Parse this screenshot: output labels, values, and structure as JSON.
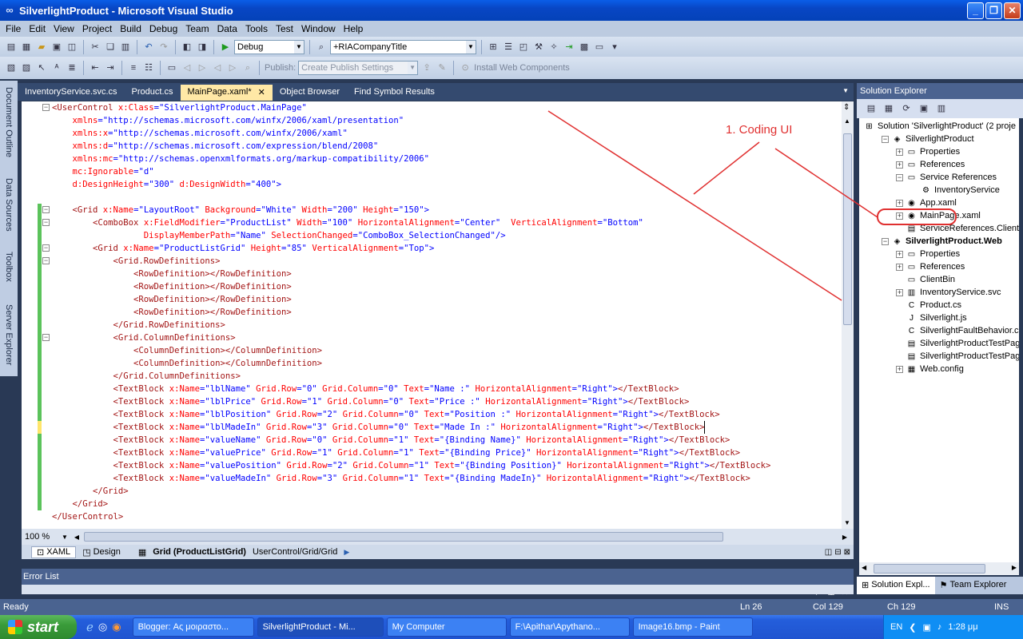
{
  "window": {
    "title": "SilverlightProduct - Microsoft Visual Studio"
  },
  "menu": [
    "File",
    "Edit",
    "View",
    "Project",
    "Build",
    "Debug",
    "Team",
    "Data",
    "Tools",
    "Test",
    "Window",
    "Help"
  ],
  "toolbar": {
    "config": "Debug",
    "startup": "+RIACompanyTitle",
    "publish_label": "Publish:",
    "publish_value": "Create Publish Settings",
    "install": "Install Web Components"
  },
  "left_rail": [
    "Document Outline",
    "Data Sources",
    "Toolbox",
    "Server Explorer"
  ],
  "tabs": [
    {
      "label": "InventoryService.svc.cs"
    },
    {
      "label": "Product.cs"
    },
    {
      "label": "MainPage.xaml*"
    },
    {
      "label": "Object Browser"
    },
    {
      "label": "Find Symbol Results"
    }
  ],
  "code": [
    [
      [
        "t",
        "<UserControl "
      ],
      [
        "a",
        "x:Class"
      ],
      [
        "b",
        "=\"SilverlightProduct.MainPage\""
      ]
    ],
    [
      [
        "a",
        "    xmlns"
      ],
      [
        "b",
        "=\"http://schemas.microsoft.com/winfx/2006/xaml/presentation\""
      ]
    ],
    [
      [
        "a",
        "    xmlns:x"
      ],
      [
        "b",
        "=\"http://schemas.microsoft.com/winfx/2006/xaml\""
      ]
    ],
    [
      [
        "a",
        "    xmlns:d"
      ],
      [
        "b",
        "=\"http://schemas.microsoft.com/expression/blend/2008\""
      ]
    ],
    [
      [
        "a",
        "    xmlns:mc"
      ],
      [
        "b",
        "=\"http://schemas.openxmlformats.org/markup-compatibility/2006\""
      ]
    ],
    [
      [
        "a",
        "    mc:Ignorable"
      ],
      [
        "b",
        "=\"d\""
      ]
    ],
    [
      [
        "a",
        "    d:DesignHeight"
      ],
      [
        "b",
        "=\"300\" "
      ],
      [
        "a",
        "d:DesignWidth"
      ],
      [
        "b",
        "=\"400\">"
      ]
    ],
    [],
    [
      [
        "t",
        "    <Grid "
      ],
      [
        "a",
        "x:Name"
      ],
      [
        "b",
        "=\"LayoutRoot\" "
      ],
      [
        "a",
        "Background"
      ],
      [
        "b",
        "=\"White\" "
      ],
      [
        "a",
        "Width"
      ],
      [
        "b",
        "=\"200\" "
      ],
      [
        "a",
        "Height"
      ],
      [
        "b",
        "=\"150\">"
      ]
    ],
    [
      [
        "t",
        "        <ComboBox "
      ],
      [
        "a",
        "x:FieldModifier"
      ],
      [
        "b",
        "=\"ProductList\" "
      ],
      [
        "a",
        "Width"
      ],
      [
        "b",
        "=\"100\" "
      ],
      [
        "a",
        "HorizontalAlignment"
      ],
      [
        "b",
        "=\"Center\"  "
      ],
      [
        "a",
        "VerticalAlignment"
      ],
      [
        "b",
        "=\"Bottom\""
      ]
    ],
    [
      [
        "a",
        "                  DisplayMemberPath"
      ],
      [
        "b",
        "=\"Name\" "
      ],
      [
        "a",
        "SelectionChanged"
      ],
      [
        "b",
        "=\"ComboBox_SelectionChanged\"/>"
      ]
    ],
    [
      [
        "t",
        "        <Grid "
      ],
      [
        "a",
        "x:Name"
      ],
      [
        "b",
        "=\"ProductListGrid\" "
      ],
      [
        "a",
        "Height"
      ],
      [
        "b",
        "=\"85\" "
      ],
      [
        "a",
        "VerticalAlignment"
      ],
      [
        "b",
        "=\"Top\">"
      ]
    ],
    [
      [
        "t",
        "            <Grid.RowDefinitions>"
      ]
    ],
    [
      [
        "t",
        "                <RowDefinition></RowDefinition>"
      ]
    ],
    [
      [
        "t",
        "                <RowDefinition></RowDefinition>"
      ]
    ],
    [
      [
        "t",
        "                <RowDefinition></RowDefinition>"
      ]
    ],
    [
      [
        "t",
        "                <RowDefinition></RowDefinition>"
      ]
    ],
    [
      [
        "t",
        "            </Grid.RowDefinitions>"
      ]
    ],
    [
      [
        "t",
        "            <Grid.ColumnDefinitions>"
      ]
    ],
    [
      [
        "t",
        "                <ColumnDefinition></ColumnDefinition>"
      ]
    ],
    [
      [
        "t",
        "                <ColumnDefinition></ColumnDefinition>"
      ]
    ],
    [
      [
        "t",
        "            </Grid.ColumnDefinitions>"
      ]
    ],
    [
      [
        "t",
        "            <TextBlock "
      ],
      [
        "a",
        "x:Name"
      ],
      [
        "b",
        "=\"lblName\" "
      ],
      [
        "a",
        "Grid.Row"
      ],
      [
        "b",
        "=\"0\" "
      ],
      [
        "a",
        "Grid.Column"
      ],
      [
        "b",
        "=\"0\" "
      ],
      [
        "a",
        "Text"
      ],
      [
        "b",
        "=\"Name :\" "
      ],
      [
        "a",
        "HorizontalAlignment"
      ],
      [
        "b",
        "=\"Right\">"
      ],
      [
        "t",
        "</TextBlock>"
      ]
    ],
    [
      [
        "t",
        "            <TextBlock "
      ],
      [
        "a",
        "x:Name"
      ],
      [
        "b",
        "=\"lblPrice\" "
      ],
      [
        "a",
        "Grid.Row"
      ],
      [
        "b",
        "=\"1\" "
      ],
      [
        "a",
        "Grid.Column"
      ],
      [
        "b",
        "=\"0\" "
      ],
      [
        "a",
        "Text"
      ],
      [
        "b",
        "=\"Price :\" "
      ],
      [
        "a",
        "HorizontalAlignment"
      ],
      [
        "b",
        "=\"Right\">"
      ],
      [
        "t",
        "</TextBlock>"
      ]
    ],
    [
      [
        "t",
        "            <TextBlock "
      ],
      [
        "a",
        "x:Name"
      ],
      [
        "b",
        "=\"lblPosition\" "
      ],
      [
        "a",
        "Grid.Row"
      ],
      [
        "b",
        "=\"2\" "
      ],
      [
        "a",
        "Grid.Column"
      ],
      [
        "b",
        "=\"0\" "
      ],
      [
        "a",
        "Text"
      ],
      [
        "b",
        "=\"Position :\" "
      ],
      [
        "a",
        "HorizontalAlignment"
      ],
      [
        "b",
        "=\"Right\">"
      ],
      [
        "t",
        "</TextBlock>"
      ]
    ],
    [
      [
        "t",
        "            <TextBlock "
      ],
      [
        "a",
        "x:Name"
      ],
      [
        "b",
        "=\"lblMadeIn\" "
      ],
      [
        "a",
        "Grid.Row"
      ],
      [
        "b",
        "=\"3\" "
      ],
      [
        "a",
        "Grid.Column"
      ],
      [
        "b",
        "=\"0\" "
      ],
      [
        "a",
        "Text"
      ],
      [
        "b",
        "=\"Made In :\" "
      ],
      [
        "a",
        "HorizontalAlignment"
      ],
      [
        "b",
        "=\"Right\">"
      ],
      [
        "t",
        "</TextBlock>"
      ]
    ],
    [
      [
        "t",
        "            <TextBlock "
      ],
      [
        "a",
        "x:Name"
      ],
      [
        "b",
        "=\"valueName\" "
      ],
      [
        "a",
        "Grid.Row"
      ],
      [
        "b",
        "=\"0\" "
      ],
      [
        "a",
        "Grid.Column"
      ],
      [
        "b",
        "=\"1\" "
      ],
      [
        "a",
        "Text"
      ],
      [
        "b",
        "=\"{Binding Name}\" "
      ],
      [
        "a",
        "HorizontalAlignment"
      ],
      [
        "b",
        "=\"Right\">"
      ],
      [
        "t",
        "</TextBlock>"
      ]
    ],
    [
      [
        "t",
        "            <TextBlock "
      ],
      [
        "a",
        "x:Name"
      ],
      [
        "b",
        "=\"valuePrice\" "
      ],
      [
        "a",
        "Grid.Row"
      ],
      [
        "b",
        "=\"1\" "
      ],
      [
        "a",
        "Grid.Column"
      ],
      [
        "b",
        "=\"1\" "
      ],
      [
        "a",
        "Text"
      ],
      [
        "b",
        "=\"{Binding Price}\" "
      ],
      [
        "a",
        "HorizontalAlignment"
      ],
      [
        "b",
        "=\"Right\">"
      ],
      [
        "t",
        "</TextBlock>"
      ]
    ],
    [
      [
        "t",
        "            <TextBlock "
      ],
      [
        "a",
        "x:Name"
      ],
      [
        "b",
        "=\"valuePosition\" "
      ],
      [
        "a",
        "Grid.Row"
      ],
      [
        "b",
        "=\"2\" "
      ],
      [
        "a",
        "Grid.Column"
      ],
      [
        "b",
        "=\"1\" "
      ],
      [
        "a",
        "Text"
      ],
      [
        "b",
        "=\"{Binding Position}\" "
      ],
      [
        "a",
        "HorizontalAlignment"
      ],
      [
        "b",
        "=\"Right\">"
      ],
      [
        "t",
        "</TextBlock>"
      ]
    ],
    [
      [
        "t",
        "            <TextBlock "
      ],
      [
        "a",
        "x:Name"
      ],
      [
        "b",
        "=\"valueMadeIn\" "
      ],
      [
        "a",
        "Grid.Row"
      ],
      [
        "b",
        "=\"3\" "
      ],
      [
        "a",
        "Grid.Column"
      ],
      [
        "b",
        "=\"1\" "
      ],
      [
        "a",
        "Text"
      ],
      [
        "b",
        "=\"{Binding MadeIn}\" "
      ],
      [
        "a",
        "HorizontalAlignment"
      ],
      [
        "b",
        "=\"Right\">"
      ],
      [
        "t",
        "</TextBlock>"
      ]
    ],
    [
      [
        "t",
        "        </Grid>"
      ]
    ],
    [
      [
        "t",
        "    </Grid>"
      ]
    ],
    [
      [
        "t",
        "</UserControl>"
      ]
    ]
  ],
  "editor": {
    "zoom": "100 %",
    "view_xaml": "XAML",
    "view_design": "Design",
    "breadcrumb_bold": "Grid (ProductListGrid)",
    "breadcrumb_path": "UserControl/Grid/Grid"
  },
  "error_list": {
    "title": "Error List"
  },
  "solution_explorer": {
    "title": "Solution Explorer",
    "items": [
      {
        "label": "Solution 'SilverlightProduct' (2 proje",
        "icon": "solution-icon",
        "bold": false
      },
      {
        "label": "SilverlightProduct",
        "icon": "project-icon",
        "bold": false
      },
      {
        "label": "Properties",
        "icon": "folder-icon",
        "bold": false
      },
      {
        "label": "References",
        "icon": "folder-icon",
        "bold": false
      },
      {
        "label": "Service References",
        "icon": "folder-icon",
        "bold": false
      },
      {
        "label": "InventoryService",
        "icon": "service-icon",
        "bold": false
      },
      {
        "label": "App.xaml",
        "icon": "xaml-icon",
        "bold": false
      },
      {
        "label": "MainPage.xaml",
        "icon": "xaml-icon",
        "bold": false
      },
      {
        "label": "ServiceReferences.ClientCo",
        "icon": "file-icon",
        "bold": false
      },
      {
        "label": "SilverlightProduct.Web",
        "icon": "web-project-icon",
        "bold": true
      },
      {
        "label": "Properties",
        "icon": "folder-icon",
        "bold": false
      },
      {
        "label": "References",
        "icon": "folder-icon",
        "bold": false
      },
      {
        "label": "ClientBin",
        "icon": "folder-icon",
        "bold": false
      },
      {
        "label": "InventoryService.svc",
        "icon": "svc-icon",
        "bold": false
      },
      {
        "label": "Product.cs",
        "icon": "cs-icon",
        "bold": false
      },
      {
        "label": "Silverlight.js",
        "icon": "js-icon",
        "bold": false
      },
      {
        "label": "SilverlightFaultBehavior.cs",
        "icon": "cs-icon",
        "bold": false
      },
      {
        "label": "SilverlightProductTestPage",
        "icon": "file-icon",
        "bold": false
      },
      {
        "label": "SilverlightProductTestPage",
        "icon": "file-icon",
        "bold": false
      },
      {
        "label": "Web.config",
        "icon": "config-icon",
        "bold": false
      }
    ],
    "tabs": [
      "Solution Expl...",
      "Team Explorer"
    ]
  },
  "annotation": {
    "text": "1. Coding UI",
    "color": "#e03030"
  },
  "status": {
    "left": "Ready",
    "ln": "Ln 26",
    "col": "Col 129",
    "ch": "Ch 129",
    "mode": "INS"
  },
  "taskbar": {
    "start": "start",
    "tasks": [
      "Blogger: Ας μοιραστο...",
      "SilverlightProduct - Mi...",
      "My Computer",
      "F:\\Apithar\\Apythano...",
      "Image16.bmp - Paint"
    ],
    "lang": "EN",
    "clock": "1:28 μμ"
  }
}
